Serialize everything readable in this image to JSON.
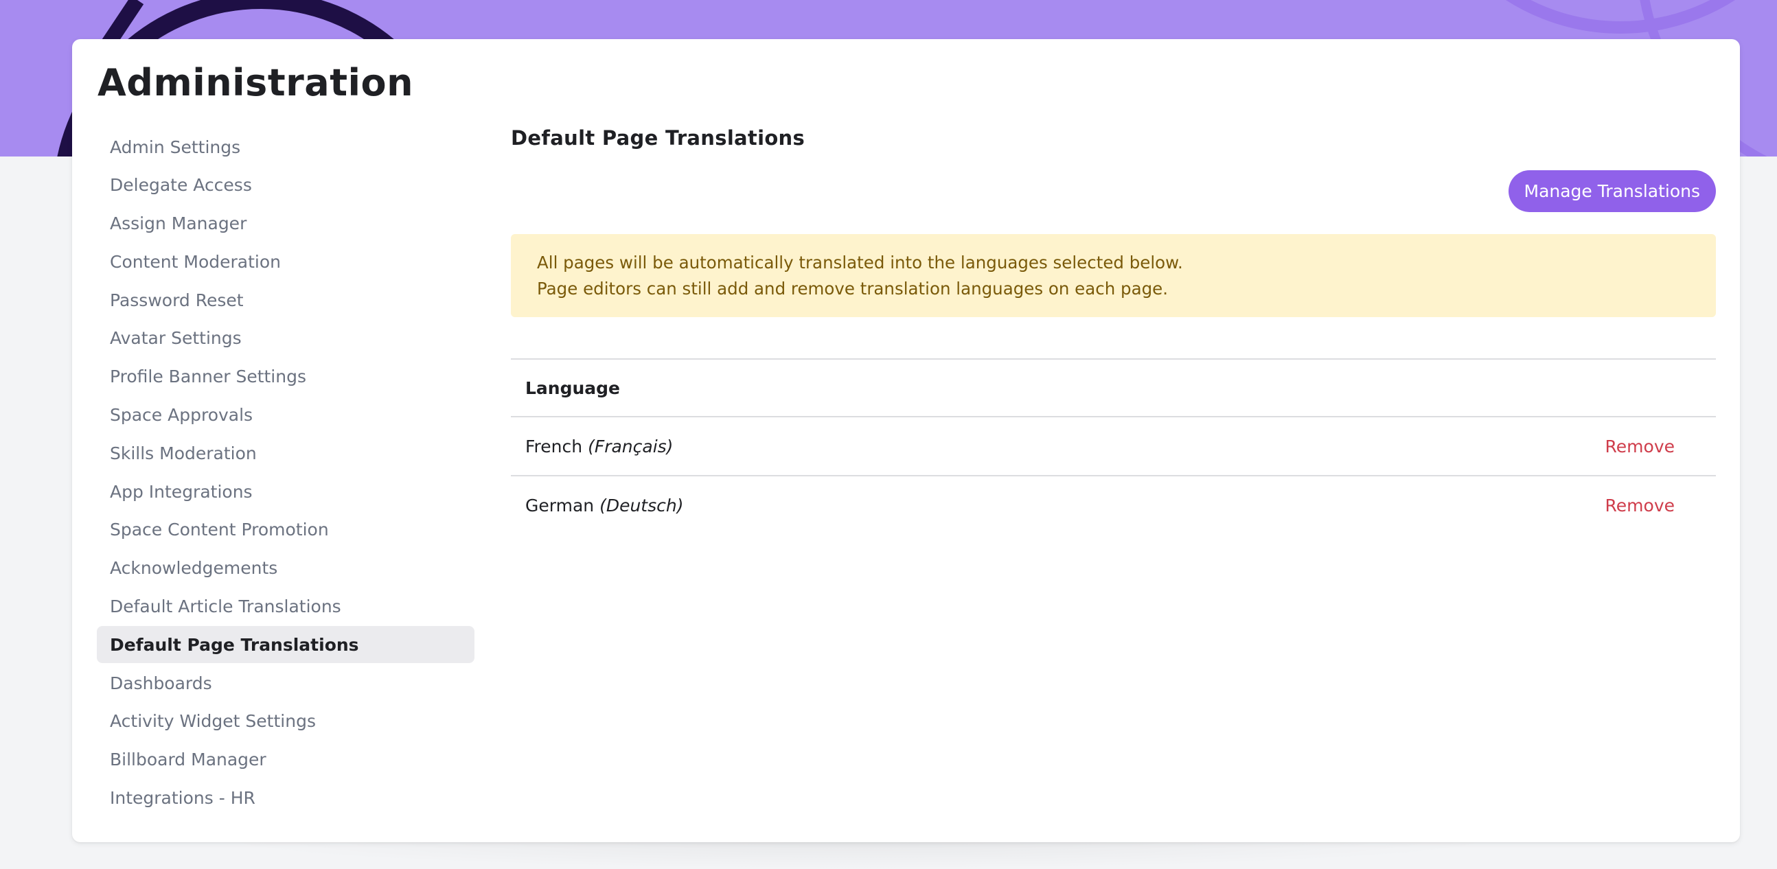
{
  "page": {
    "title": "Administration"
  },
  "sidebar": {
    "items": [
      {
        "label": "Admin Settings"
      },
      {
        "label": "Delegate Access"
      },
      {
        "label": "Assign Manager"
      },
      {
        "label": "Content Moderation"
      },
      {
        "label": "Password Reset"
      },
      {
        "label": "Avatar Settings"
      },
      {
        "label": "Profile Banner Settings"
      },
      {
        "label": "Space Approvals"
      },
      {
        "label": "Skills Moderation"
      },
      {
        "label": "App Integrations"
      },
      {
        "label": "Space Content Promotion"
      },
      {
        "label": "Acknowledgements"
      },
      {
        "label": "Default Article Translations"
      },
      {
        "label": "Default Page Translations",
        "active": true
      },
      {
        "label": "Dashboards"
      },
      {
        "label": "Activity Widget Settings"
      },
      {
        "label": "Billboard Manager"
      },
      {
        "label": "Integrations - HR"
      }
    ]
  },
  "main": {
    "title": "Default Page Translations",
    "manage_button": "Manage Translations",
    "notice": {
      "line1": "All pages will be automatically translated into the languages selected below.",
      "line2": "Page editors can still add and remove translation languages on each page."
    },
    "table": {
      "header": "Language",
      "rows": [
        {
          "name": "French",
          "native": "(Français)",
          "action": "Remove"
        },
        {
          "name": "German",
          "native": "(Deutsch)",
          "action": "Remove"
        }
      ]
    }
  },
  "colors": {
    "banner": "#a78bf0",
    "accent": "#9061ea",
    "notice_bg": "#fef3cd",
    "notice_text": "#7a5a0a",
    "danger": "#cf3d4b"
  }
}
